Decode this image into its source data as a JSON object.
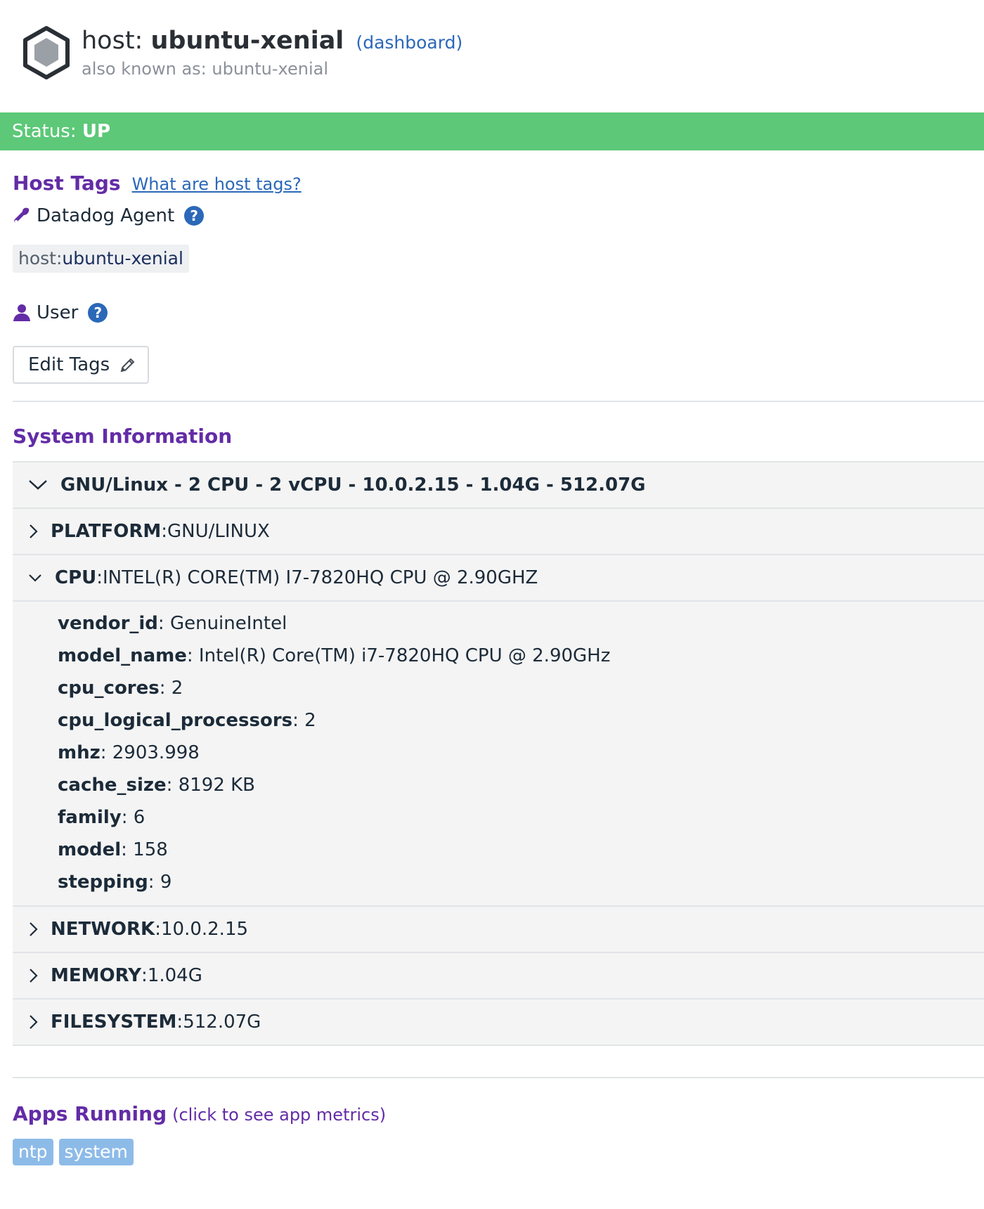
{
  "header": {
    "host_prefix": "host: ",
    "host_name": "ubuntu-xenial",
    "dashboard_link": "(dashboard)",
    "aka": "also known as: ubuntu-xenial",
    "logo_icon": "hexagon-host-icon"
  },
  "status": {
    "label": "Status: ",
    "value": "UP",
    "color": "#5cc878"
  },
  "host_tags": {
    "title": "Host Tags",
    "help_link": "What are host tags?",
    "sources": [
      {
        "name": "Datadog Agent",
        "icon": "wrench-icon",
        "tags": [
          {
            "key": "host:",
            "value": "ubuntu-xenial"
          }
        ]
      },
      {
        "name": "User",
        "icon": "user-icon",
        "tags": []
      }
    ],
    "help_icon_glyph": "?",
    "edit_button": "Edit Tags"
  },
  "system_info": {
    "title": "System Information",
    "summary": "GNU/Linux - 2 CPU - 2 vCPU - 10.0.2.15 - 1.04G - 512.07G",
    "sections": [
      {
        "key": "PLATFORM",
        "sep": " : ",
        "value": "GNU/LINUX",
        "expanded": false
      },
      {
        "key": "CPU",
        "sep": " : ",
        "value": "INTEL(R) CORE(TM) I7-7820HQ CPU @ 2.90GHZ",
        "expanded": true
      },
      {
        "key": "NETWORK",
        "sep": " : ",
        "value": "10.0.2.15",
        "expanded": false
      },
      {
        "key": "MEMORY",
        "sep": " : ",
        "value": "1.04G",
        "expanded": false
      },
      {
        "key": "FILESYSTEM",
        "sep": " : ",
        "value": "512.07G",
        "expanded": false
      }
    ],
    "cpu_details": [
      {
        "k": "vendor_id",
        "v": ": GenuineIntel"
      },
      {
        "k": "model_name",
        "v": ": Intel(R) Core(TM) i7-7820HQ CPU @ 2.90GHz"
      },
      {
        "k": "cpu_cores",
        "v": ": 2"
      },
      {
        "k": "cpu_logical_processors",
        "v": ": 2"
      },
      {
        "k": "mhz",
        "v": ": 2903.998"
      },
      {
        "k": "cache_size",
        "v": ": 8192 KB"
      },
      {
        "k": "family",
        "v": ": 6"
      },
      {
        "k": "model",
        "v": ": 158"
      },
      {
        "k": "stepping",
        "v": ": 9"
      }
    ]
  },
  "apps": {
    "title": "Apps Running",
    "hint": "(click to see app metrics)",
    "items": [
      "ntp",
      "system"
    ]
  },
  "colors": {
    "accent_purple": "#632ca6",
    "link_blue": "#2b68b8",
    "app_chip": "#8dbbe8"
  }
}
